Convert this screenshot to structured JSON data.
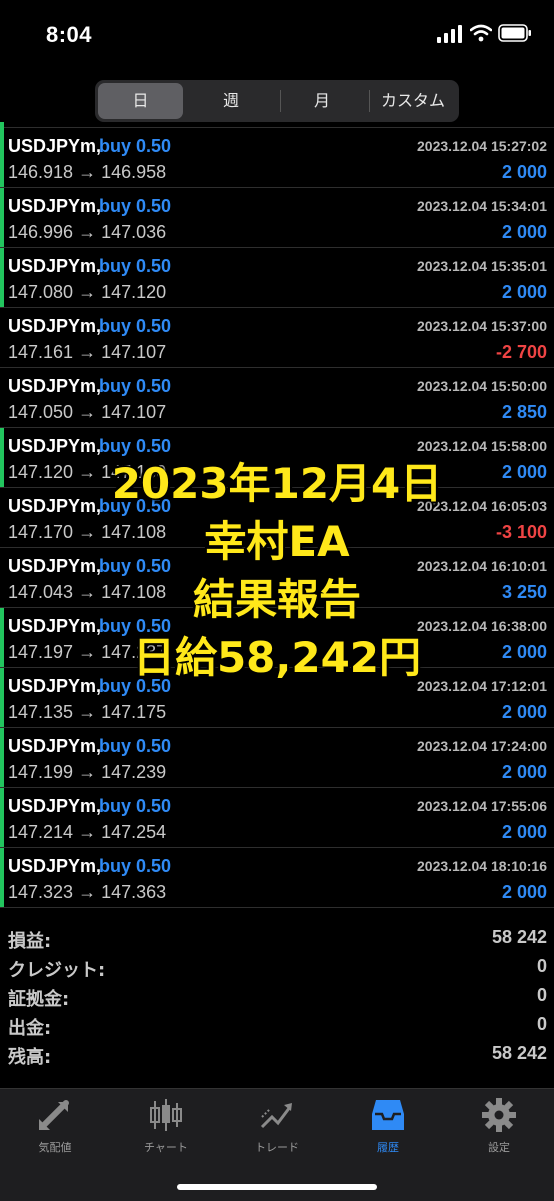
{
  "status_bar": {
    "time": "8:04"
  },
  "segments": [
    "日",
    "週",
    "月",
    "カスタム"
  ],
  "partial_row_color": "#2f8af5",
  "deals": [
    {
      "symbol": "USDJPYm,",
      "side": "buy 0.50",
      "datetime": "2023.12.04 15:27:02",
      "prices": "146.918 → 146.958",
      "profit": "2 000",
      "profit_color": "#2f8af5",
      "bar": "#22c55e"
    },
    {
      "symbol": "USDJPYm,",
      "side": "buy 0.50",
      "datetime": "2023.12.04 15:34:01",
      "prices": "146.996 → 147.036",
      "profit": "2 000",
      "profit_color": "#2f8af5",
      "bar": "#22c55e"
    },
    {
      "symbol": "USDJPYm,",
      "side": "buy 0.50",
      "datetime": "2023.12.04 15:35:01",
      "prices": "147.080 → 147.120",
      "profit": "2 000",
      "profit_color": "#2f8af5",
      "bar": "#22c55e"
    },
    {
      "symbol": "USDJPYm,",
      "side": "buy 0.50",
      "datetime": "2023.12.04 15:37:00",
      "prices": "147.161 → 147.107",
      "profit": "-2 700",
      "profit_color": "#ef4444",
      "bar": "transparent"
    },
    {
      "symbol": "USDJPYm,",
      "side": "buy 0.50",
      "datetime": "2023.12.04 15:50:00",
      "prices": "147.050 → 147.107",
      "profit": "2 850",
      "profit_color": "#2f8af5",
      "bar": "transparent"
    },
    {
      "symbol": "USDJPYm,",
      "side": "buy 0.50",
      "datetime": "2023.12.04 15:58:00",
      "prices": "147.120 → 147.160",
      "profit": "2 000",
      "profit_color": "#2f8af5",
      "bar": "#22c55e"
    },
    {
      "symbol": "USDJPYm,",
      "side": "buy 0.50",
      "datetime": "2023.12.04 16:05:03",
      "prices": "147.170 → 147.108",
      "profit": "-3 100",
      "profit_color": "#ef4444",
      "bar": "transparent"
    },
    {
      "symbol": "USDJPYm,",
      "side": "buy 0.50",
      "datetime": "2023.12.04 16:10:01",
      "prices": "147.043 → 147.108",
      "profit": "3 250",
      "profit_color": "#2f8af5",
      "bar": "transparent"
    },
    {
      "symbol": "USDJPYm,",
      "side": "buy 0.50",
      "datetime": "2023.12.04 16:38:00",
      "prices": "147.197 → 147.237",
      "profit": "2 000",
      "profit_color": "#2f8af5",
      "bar": "#22c55e"
    },
    {
      "symbol": "USDJPYm,",
      "side": "buy 0.50",
      "datetime": "2023.12.04 17:12:01",
      "prices": "147.135 → 147.175",
      "profit": "2 000",
      "profit_color": "#2f8af5",
      "bar": "#22c55e"
    },
    {
      "symbol": "USDJPYm,",
      "side": "buy 0.50",
      "datetime": "2023.12.04 17:24:00",
      "prices": "147.199 → 147.239",
      "profit": "2 000",
      "profit_color": "#2f8af5",
      "bar": "#22c55e"
    },
    {
      "symbol": "USDJPYm,",
      "side": "buy 0.50",
      "datetime": "2023.12.04 17:55:06",
      "prices": "147.214 → 147.254",
      "profit": "2 000",
      "profit_color": "#2f8af5",
      "bar": "#22c55e"
    },
    {
      "symbol": "USDJPYm,",
      "side": "buy 0.50",
      "datetime": "2023.12.04 18:10:16",
      "prices": "147.323 → 147.363",
      "profit": "2 000",
      "profit_color": "#2f8af5",
      "bar": "#22c55e"
    }
  ],
  "totals": [
    {
      "label": "損益:",
      "value": "58 242"
    },
    {
      "label": "クレジット:",
      "value": "0"
    },
    {
      "label": "証拠金:",
      "value": "0"
    },
    {
      "label": "出金:",
      "value": "0"
    },
    {
      "label": "残高:",
      "value": "58 242"
    }
  ],
  "overlay": [
    "2023年12月4日",
    "幸村EA",
    "結果報告",
    "日給58,242円"
  ],
  "tabs": [
    {
      "label": "気配値",
      "icon": "quotes-icon"
    },
    {
      "label": "チャート",
      "icon": "chart-icon"
    },
    {
      "label": "トレード",
      "icon": "trade-icon"
    },
    {
      "label": "履歴",
      "icon": "history-icon",
      "active": true
    },
    {
      "label": "設定",
      "icon": "settings-icon"
    }
  ],
  "colors": {
    "accent": "#2f8af5",
    "loss": "#ef4444",
    "overlay": "#ffe81a",
    "win_bar": "#22c55e"
  }
}
